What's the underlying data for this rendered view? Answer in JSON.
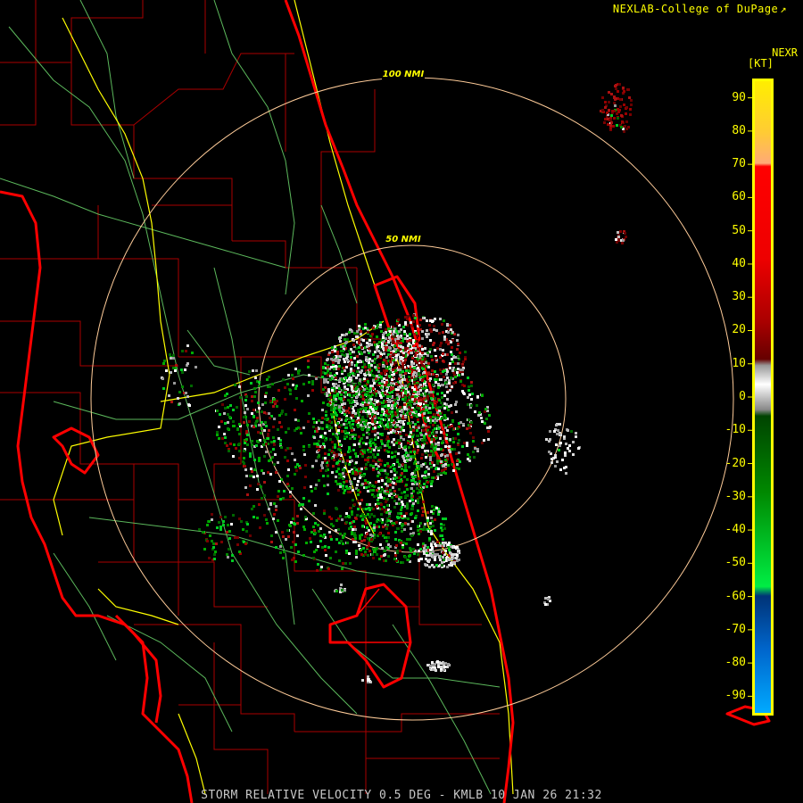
{
  "header": {
    "credit": "NEXLAB-College of DuPage",
    "credit_glyph": "↗"
  },
  "legend": {
    "title": "NEXR",
    "unit": "[KT]",
    "ticks": [
      "90",
      "80",
      "70",
      "60",
      "50",
      "40",
      "30",
      "20",
      "10",
      "0",
      "-10",
      "-20",
      "-30",
      "-40",
      "-50",
      "-60",
      "-70",
      "-80",
      "-90"
    ],
    "tick_values": [
      90,
      80,
      70,
      60,
      50,
      40,
      30,
      20,
      10,
      0,
      -10,
      -20,
      -30,
      -40,
      -50,
      -60,
      -70,
      -80,
      -90
    ],
    "range": [
      -95,
      95
    ],
    "colors": {
      "top": "#ffee00",
      "peach": "#ffaa77",
      "red": "#ff0000",
      "dark_red": "#7a0000",
      "gray": "#bbbbbb",
      "dark_green": "#005500",
      "green": "#00ee00",
      "blue": "#0055aa",
      "light_blue": "#00aaff"
    }
  },
  "range_rings": [
    {
      "label": "100 NMI",
      "nmi": 100
    },
    {
      "label": "50 NMI",
      "nmi": 50
    }
  ],
  "map_colors": {
    "coastline": "#ff0000",
    "county_lines": "#aa0000",
    "roads_highway": "#ffff00",
    "roads_minor": "#66cc66",
    "range_ring": "#ffcc99"
  },
  "footer": {
    "product": "STORM RELATIVE VELOCITY 0.5 DEG - KMLB 10 JAN 26 21:32"
  }
}
